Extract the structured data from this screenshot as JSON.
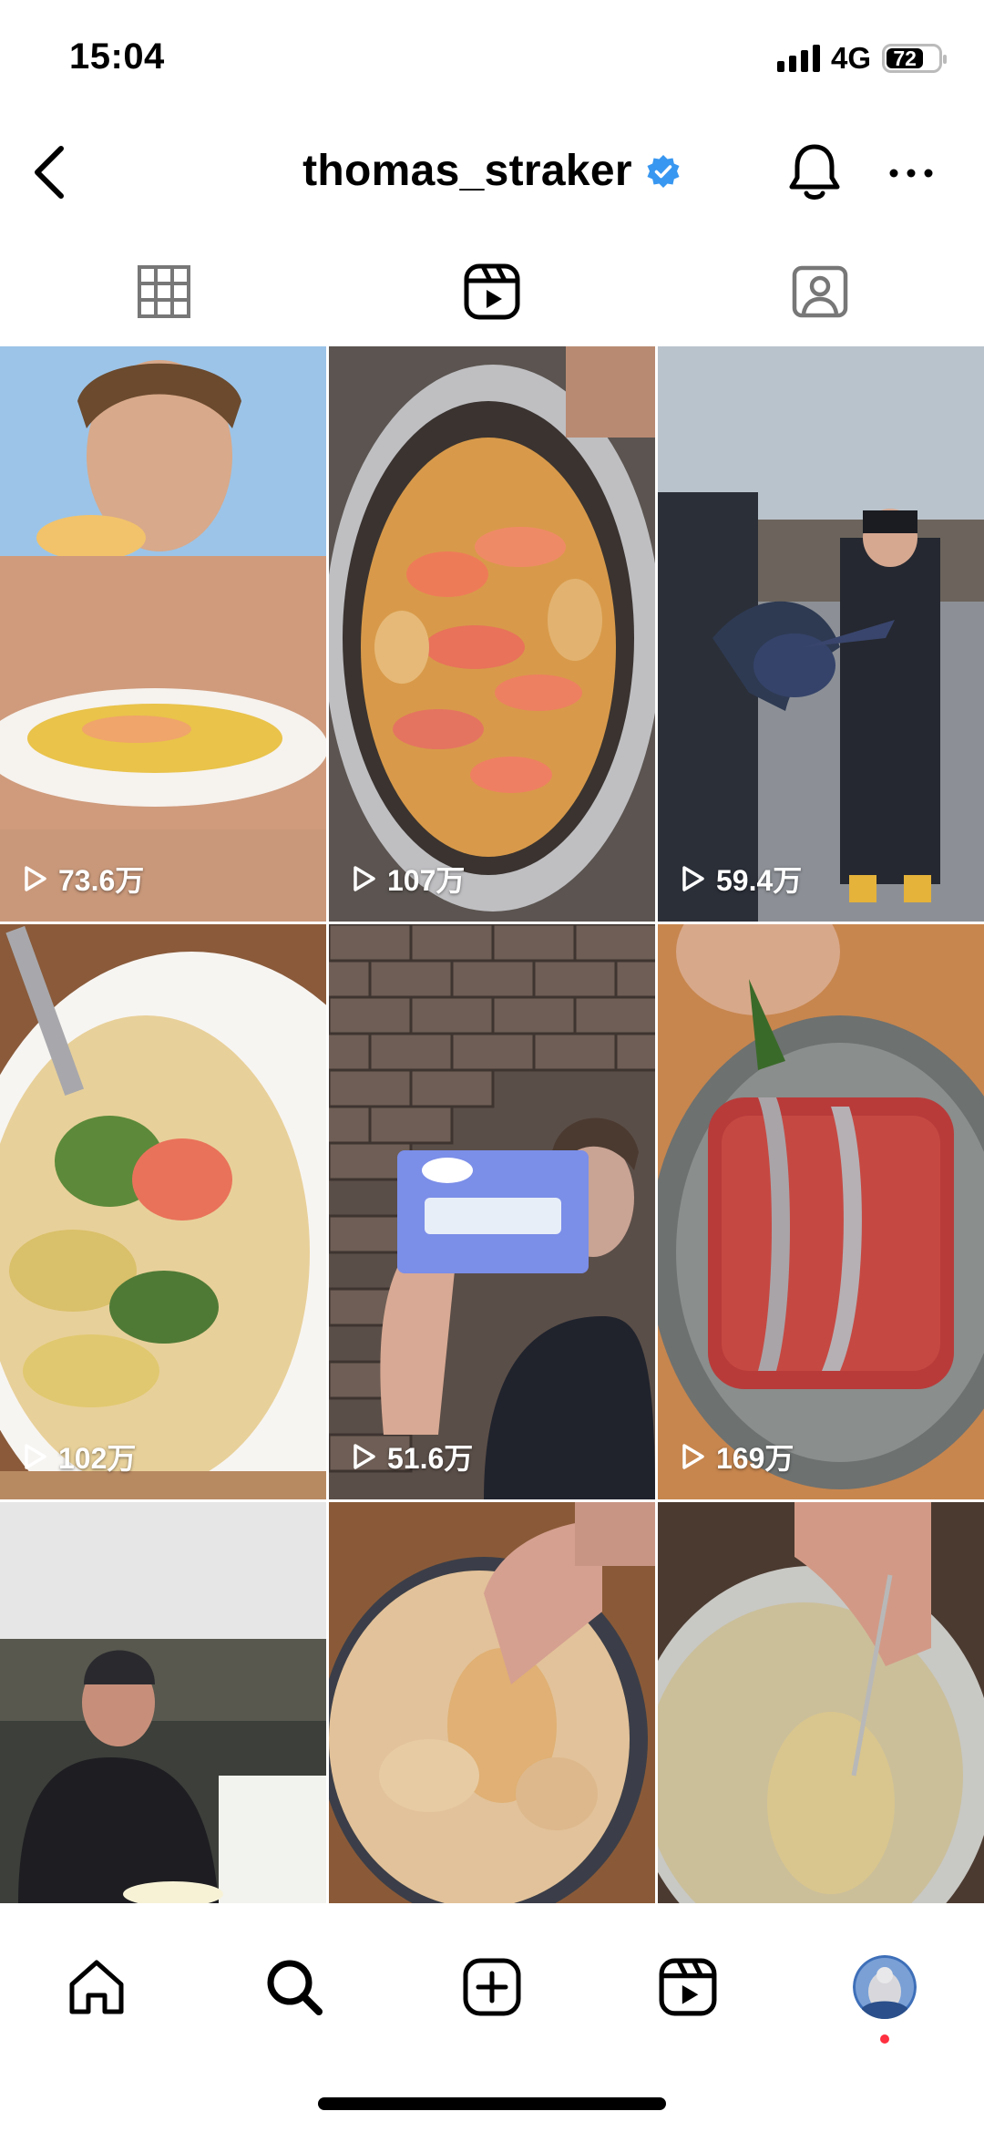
{
  "status": {
    "time": "15:04",
    "network": "4G",
    "battery": "72"
  },
  "header": {
    "username": "thomas_straker"
  },
  "tabs": [
    {
      "name": "posts",
      "icon": "grid-icon",
      "active": false
    },
    {
      "name": "reels",
      "icon": "reels-icon",
      "active": true
    },
    {
      "name": "tagged",
      "icon": "tagged-icon",
      "active": false
    }
  ],
  "reels": [
    {
      "views": "73.6万",
      "subject": "man eating shrimp"
    },
    {
      "views": "107万",
      "subject": "prawns in foil pan"
    },
    {
      "views": "59.4万",
      "subject": "lobster on dock"
    },
    {
      "views": "102万",
      "subject": "salad plate"
    },
    {
      "views": "51.6万",
      "subject": "butter package"
    },
    {
      "views": "169万",
      "subject": "tuna tartare anchovies"
    },
    {
      "views": "",
      "subject": "captain eating soup"
    },
    {
      "views": "",
      "subject": "spiced butter scoop"
    },
    {
      "views": "",
      "subject": "dip with spoon"
    }
  ],
  "nav": {
    "items": [
      "home-icon",
      "search-icon",
      "create-icon",
      "reels-icon",
      "profile-avatar"
    ],
    "notification": true
  },
  "colors": {
    "verified": "#3897f0",
    "notification_dot": "#ff3040"
  }
}
